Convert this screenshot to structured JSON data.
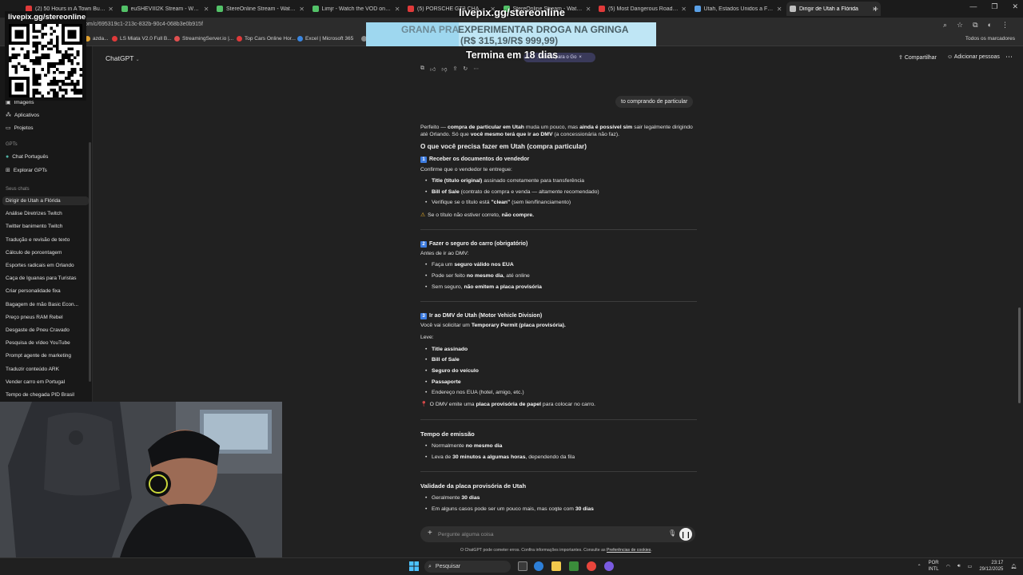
{
  "browser": {
    "tabs": [
      {
        "label": "(2) 50 Hours in A Town Built Ar",
        "color": "#e03a3a",
        "active": false
      },
      {
        "label": "euSHEVIII2K Stream - Watch Li",
        "color": "#53c268",
        "active": false
      },
      {
        "label": "StereOnline Stream - Watch Li",
        "color": "#53c268",
        "active": false
      },
      {
        "label": "Limjr - Watch the VOD on Kick",
        "color": "#53c268",
        "active": false
      },
      {
        "label": "(5) PORSCHE GT3 CHASSIS DOS",
        "color": "#e03a3a",
        "active": false
      },
      {
        "label": "StereOnline Stream - Watch Li",
        "color": "#53c268",
        "active": false
      },
      {
        "label": "(5) Most Dangerous Road? Sco",
        "color": "#e03a3a",
        "active": false
      },
      {
        "label": "Utah, Estados Unidos a Filadélf",
        "color": "#5aa0e6",
        "active": false
      },
      {
        "label": "Dirigir de Utah a Flórida",
        "color": "#bfbfbf",
        "active": true
      }
    ],
    "url": "om/c/695319c1-213c-832b-90c4-068b3e0b915f",
    "bookmarks": [
      "azda...",
      "LS Miata V2.0 Full B...",
      "StreamingServer.io |...",
      "Top Cars Online Hor...",
      "Excel | Microsoft 365",
      "T"
    ],
    "bookmarks_all": "Todos os marcadores"
  },
  "sidebar": {
    "top_items": [
      {
        "label": "Imagens",
        "icon": "image-icon"
      },
      {
        "label": "Aplicativos",
        "icon": "apps-icon"
      },
      {
        "label": "Projetos",
        "icon": "folder-icon"
      }
    ],
    "gpts_header": "GPTs",
    "gpts": [
      {
        "label": "Chat Português",
        "icon": "gpt-icon"
      },
      {
        "label": "Explorar GPTs",
        "icon": "explore-icon"
      }
    ],
    "chats_header": "Seus chats",
    "chats": [
      "Dirigir de Utah a Flórida",
      "Análise Diretrizes Twitch",
      "Twitter banimento Twitch",
      "Tradução e revisão de texto",
      "Cálculo de porcentagem",
      "Esportes radicais em Orlando",
      "Caça de Iguanas para Turistas",
      "Criar personalidade fixa",
      "Bagagem de mão Basic Econ...",
      "Preço pneus RAM Rebel",
      "Desgaste de Pneu Cravado",
      "Pesquisa de vídeo YouTube",
      "Prompt agente de marketing",
      "Traduzir conteúdo ARK",
      "Vender carro em Portugal",
      "Tempo de chegada PID Brasil"
    ]
  },
  "header": {
    "model": "ChatGPT",
    "chip": "...lidade para o Go",
    "share": "Compartilhar",
    "add_people": "Adicionar pessoas"
  },
  "conversation": {
    "user_message": "to comprando de particular",
    "intro_a": "Perfeito — ",
    "intro_b": "compra de particular em Utah",
    "intro_c": " muda um pouco, mas ",
    "intro_d": "ainda é possível sim",
    "intro_e": " sair legalmente dirigindo até Orlando. Só que ",
    "intro_f": "você mesmo terá que ir ao DMV",
    "intro_g": " (a concessionária não faz).",
    "heading": "O que você precisa fazer em Utah (compra particular)",
    "s1_num": "1",
    "s1_title": "Receber os documentos do vendedor",
    "s1_lead": "Confirme que o vendedor te entregue:",
    "s1_i1_b": "Title (título original)",
    "s1_i1_t": " assinado corretamente para transferência",
    "s1_i2_b": "Bill of Sale",
    "s1_i2_t": " (contrato de compra e venda — altamente recomendado)",
    "s1_i3_t": "Verifique se o título está ",
    "s1_i3_b": "\"clean\"",
    "s1_i3_e": " (sem lien/financiamento)",
    "s1_warn_t": "Se o título não estiver correto, ",
    "s1_warn_b": "não compre.",
    "s2_num": "2",
    "s2_title": "Fazer o seguro do carro (obrigatório)",
    "s2_lead": "Antes de ir ao DMV:",
    "s2_i1_t": "Faça um ",
    "s2_i1_b": "seguro válido nos EUA",
    "s2_i2_t": "Pode ser feito ",
    "s2_i2_b": "no mesmo dia",
    "s2_i2_e": ", até online",
    "s2_i3_t": "Sem seguro, ",
    "s2_i3_b": "não emitem a placa provisória",
    "s3_num": "3",
    "s3_title": "Ir ao DMV de Utah (Motor Vehicle Division)",
    "s3_lead_t": "Você vai solicitar um ",
    "s3_lead_b": "Temporary Permit (placa provisória).",
    "s3_leve": "Leve:",
    "s3_items": [
      "Title assinado",
      "Bill of Sale",
      "Seguro do veículo",
      "Passaporte"
    ],
    "s3_i5": "Endereço nos EUA (hotel, amigo, etc.)",
    "s3_note_t": "O DMV emite uma ",
    "s3_note_b": "placa provisória de papel",
    "s3_note_e": " para colocar no carro.",
    "t_heading": "Tempo de emissão",
    "t_i1_t": "Normalmente ",
    "t_i1_b": "no mesmo dia",
    "t_i2_t": "Leva de ",
    "t_i2_b": "30 minutos a algumas horas",
    "t_i2_e": ", dependendo da fila",
    "v_heading": "Validade da placa provisória de Utah",
    "v_i1_t": "Geralmente ",
    "v_i1_b": "30 dias",
    "v_i2_t": "Em alguns casos pode ser um pouco mais, mas conte com ",
    "v_i2_b": "30 dias"
  },
  "composer": {
    "placeholder": "Pergunte alguma coisa",
    "disclaimer_a": "O ChatGPT pode cometer erros. Confira informações importantes. Consulte as ",
    "disclaimer_link": "Preferências de cookies",
    "disclaimer_b": "."
  },
  "overlay": {
    "qr_label": "livepix.gg/stereonline",
    "top_url": "livepix.gg/stereonline",
    "promo_left": "GRANA PRA",
    "promo_line1": "EXPERIMENTAR DROGA NA GRINGA",
    "promo_line2": "(R$ 315,19/R$ 999,99)",
    "promo_timer": "Termina em 18 dias"
  },
  "taskbar": {
    "search": "Pesquisar",
    "lang_top": "POR",
    "lang_bottom": "INTL",
    "time": "23:17",
    "date": "29/12/2025"
  }
}
